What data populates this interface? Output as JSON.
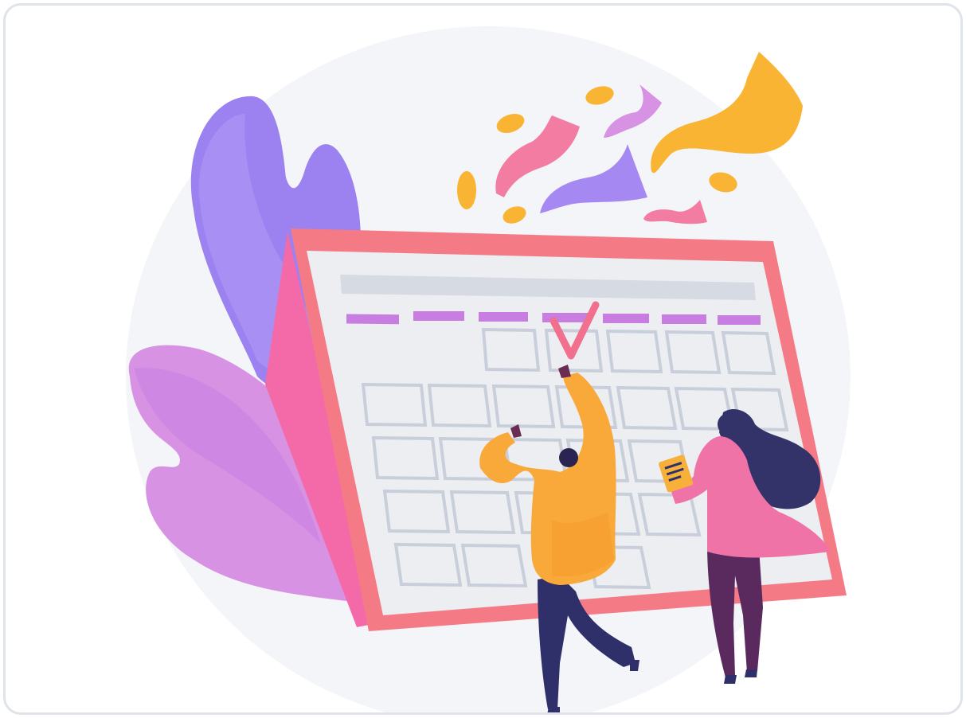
{
  "illustration": {
    "subject": "calendar-celebration",
    "colors": {
      "backdrop": "#f4f5f8",
      "frame_border": "#dfe4ea",
      "calendar_frame": "#f47a86",
      "calendar_side": "#f46aa8",
      "calendar_screen": "#eceef2",
      "calendar_header": "#d6dae2",
      "weekday_marks": "#c77ee0",
      "cells": "#c9cfda",
      "checkmark": "#f0708e",
      "leaf_purple": "#9b82f0",
      "leaf_pink": "#d892e4",
      "confetti_orange": "#f8b432",
      "confetti_pink": "#f27ca2",
      "confetti_purple": "#a688f2",
      "man_sweater": "#f8a93a",
      "man_pants": "#2f2f6a",
      "woman_top": "#f073a8",
      "woman_hair": "#33336a",
      "woman_pants": "#5a2a5e",
      "clipboard": "#f7b13a"
    },
    "calendar": {
      "weekday_marks": 7,
      "checked_cell": "first-row"
    }
  }
}
